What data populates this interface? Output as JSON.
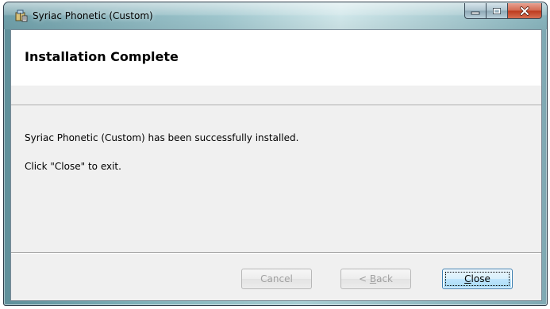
{
  "window": {
    "title": "Syriac Phonetic (Custom)",
    "app_icon": "installer-package-icon",
    "caption_buttons": {
      "minimize": "minimize-icon",
      "maximize": "maximize-icon",
      "close": "close-icon"
    }
  },
  "banner": {
    "title": "Installation Complete"
  },
  "content": {
    "message": "Syriac Phonetic (Custom) has been successfully installed.",
    "instruction": "Click \"Close\" to exit."
  },
  "buttons": {
    "cancel": {
      "label": "Cancel",
      "enabled": false
    },
    "back": {
      "prefix": "< ",
      "mnemonic": "B",
      "rest": "ack",
      "enabled": false
    },
    "close": {
      "mnemonic": "C",
      "rest": "lose",
      "enabled": true,
      "default": true
    }
  },
  "colors": {
    "frame_accent": "#9fc6cd",
    "close_caption": "#c84a2f",
    "default_button_border": "#3c7fb1"
  }
}
